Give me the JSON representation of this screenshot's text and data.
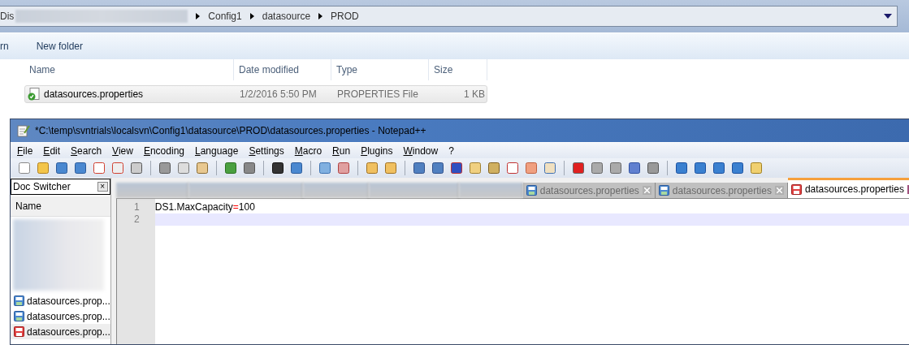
{
  "explorer": {
    "address": {
      "prefix": "Dis",
      "crumbs": [
        "Config1",
        "datasource",
        "PROD"
      ]
    },
    "toolbar": [
      "rn",
      "New folder"
    ],
    "columns": [
      "Name",
      "Date modified",
      "Type",
      "Size"
    ],
    "rows": [
      {
        "name": "datasources.properties",
        "date": "1/2/2016 5:50 PM",
        "type": "PROPERTIES File",
        "size": "1 KB",
        "selected": true
      }
    ]
  },
  "notepad": {
    "title": "*C:\\temp\\svntrials\\localsvn\\Config1\\datasource\\PROD\\datasources.properties - Notepad++",
    "menu": [
      "File",
      "Edit",
      "Search",
      "View",
      "Encoding",
      "Language",
      "Settings",
      "Macro",
      "Run",
      "Plugins",
      "Window",
      "?"
    ],
    "doc_switcher": {
      "title": "Doc Switcher",
      "close": "×",
      "column": "Name",
      "items": [
        {
          "label": "datasources.prop...",
          "modified": false,
          "selected": false
        },
        {
          "label": "datasources.prop...",
          "modified": false,
          "selected": false
        },
        {
          "label": "datasources.prop...",
          "modified": true,
          "selected": true
        }
      ]
    },
    "tabs": [
      {
        "label": "datasources.properties",
        "modified": false,
        "selected": false
      },
      {
        "label": "datasources.properties",
        "modified": false,
        "selected": false
      },
      {
        "label": "datasources.properties",
        "modified": true,
        "selected": true
      }
    ],
    "lines": [
      {
        "number": "1",
        "tokens": [
          {
            "kind": "key",
            "text": "DS1.MaxCapacity"
          },
          {
            "kind": "operator",
            "text": "="
          },
          {
            "kind": "value",
            "text": "100"
          }
        ],
        "current": false
      },
      {
        "number": "2",
        "current": true
      }
    ]
  }
}
